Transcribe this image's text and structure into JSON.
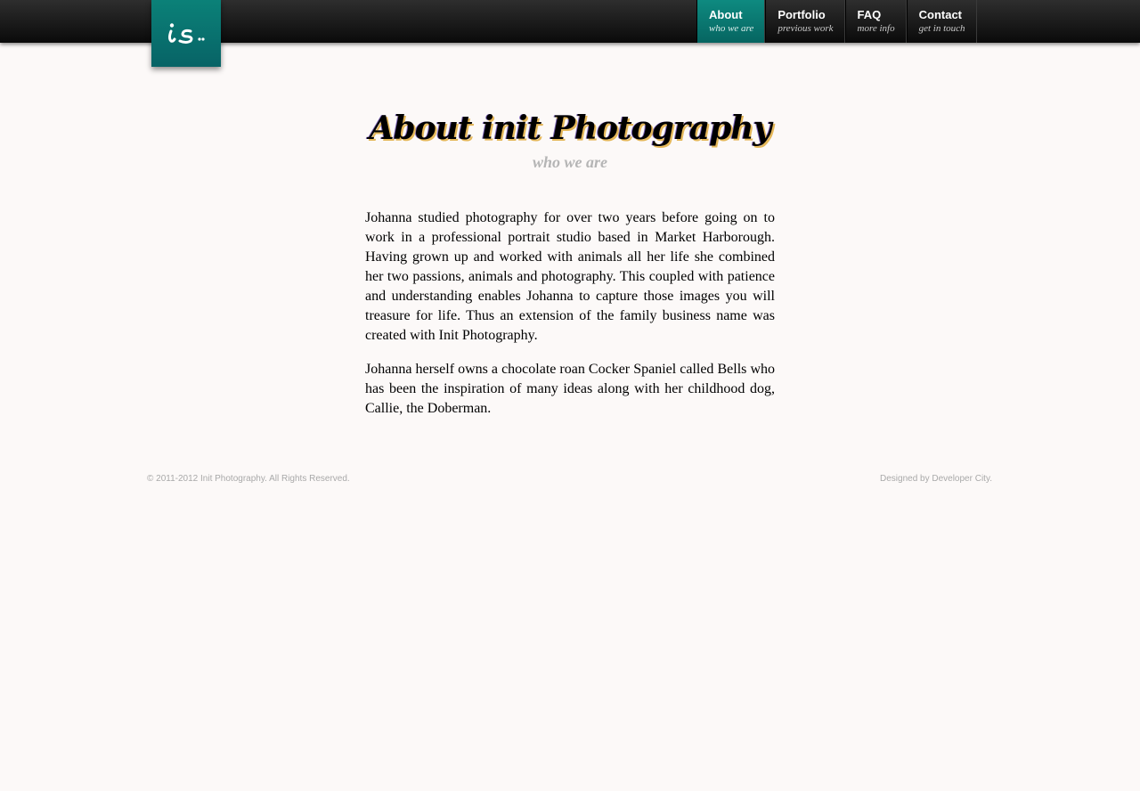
{
  "header": {
    "logo": {
      "text": "is..",
      "bg_color": "#087270"
    },
    "nav": [
      {
        "label": "About",
        "sub": "who we are",
        "active": true
      },
      {
        "label": "Portfolio",
        "sub": "previous work",
        "active": false
      },
      {
        "label": "FAQ",
        "sub": "more info",
        "active": false
      },
      {
        "label": "Contact",
        "sub": "get in touch",
        "active": false
      }
    ]
  },
  "main": {
    "title": "About init Photography",
    "subtitle": "who we are",
    "paragraphs": [
      "Johanna studied photography for over two years before going on to work in a professional portrait studio based in Market Harborough. Having grown up and worked with animals all her life she combined her two passions, animals and photography. This coupled with patience and understanding enables Johanna to capture those images you will treasure for life. Thus an extension of the family business name was created with Init Photography.",
      "Johanna herself owns a chocolate roan Cocker Spaniel called Bells who has been the inspiration of many ideas along with her childhood dog, Callie, the Doberman."
    ]
  },
  "footer": {
    "copyright": "© 2011-2012 Init Photography. All Rights Reserved.",
    "credit": "Designed by Developer City."
  },
  "colors": {
    "accent": "#0a7b76",
    "background": "#fcf9f8",
    "topbar": "#151515"
  }
}
